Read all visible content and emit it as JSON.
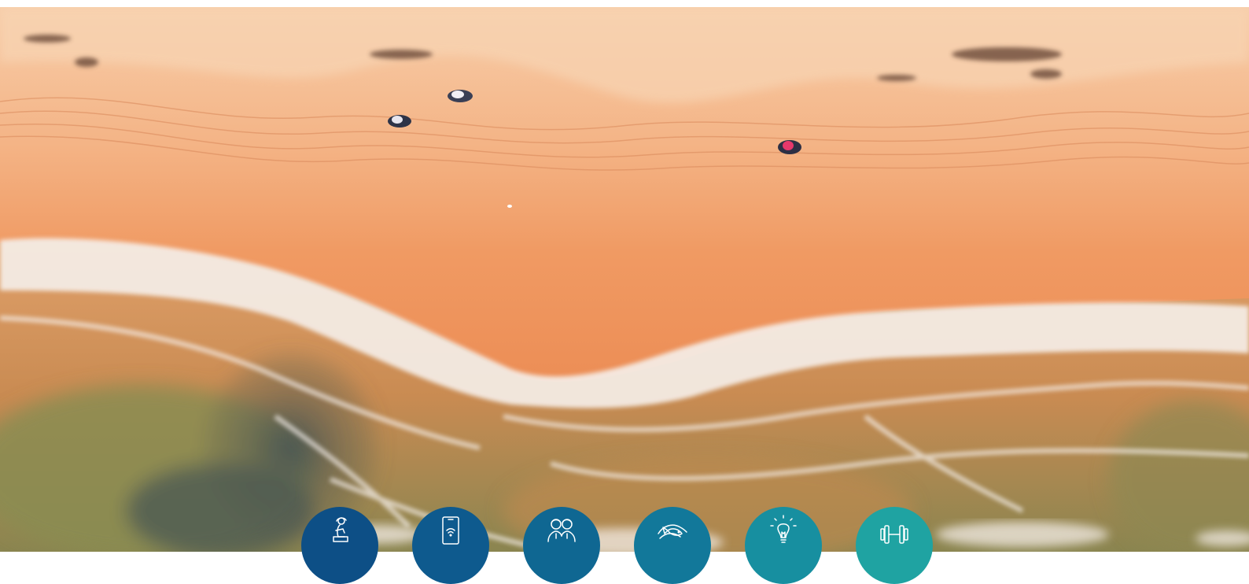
{
  "hero": {
    "image_description_icon": "aerial-beach-photo",
    "colors": {
      "sand_light": "#f6c29a",
      "sand_mid": "#f2a06b",
      "sand_wet": "#ea8a55",
      "foam": "#f4ece6",
      "shallow_water": "#d8955d",
      "rock_dark": "#4a5a57",
      "deep_water": "#7d8a55"
    }
  },
  "service_icons": [
    {
      "icon": "reading-person-icon",
      "color": "#0d4f86"
    },
    {
      "icon": "tablet-wifi-icon",
      "color": "#0e5a8e"
    },
    {
      "icon": "two-people-icon",
      "color": "#0f6792"
    },
    {
      "icon": "swimming-fish-icon",
      "color": "#12789a"
    },
    {
      "icon": "lightbulb-icon",
      "color": "#178fa0"
    },
    {
      "icon": "dumbbell-icon",
      "color": "#1fa3a2"
    }
  ]
}
